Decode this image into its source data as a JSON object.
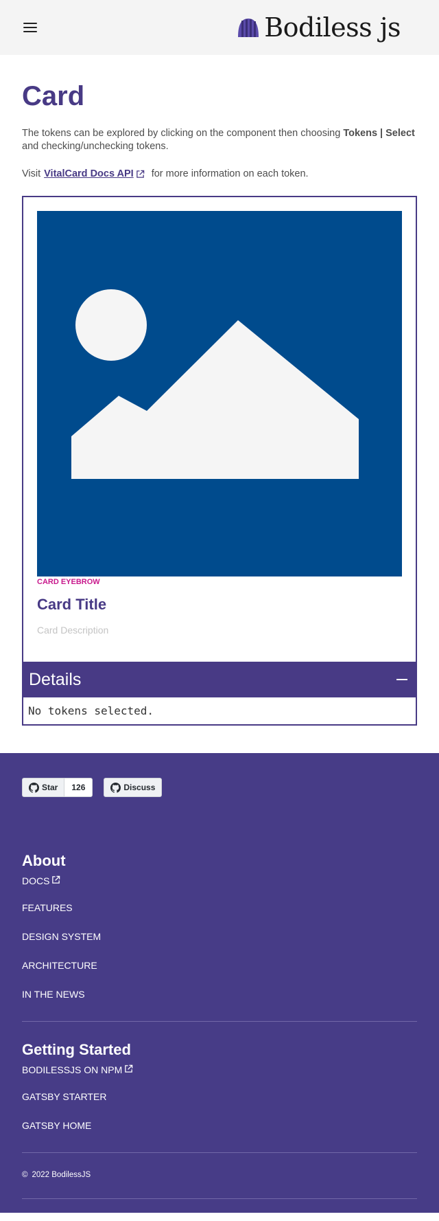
{
  "header": {
    "brand_name": "Bodiless js",
    "brand_mark": "beanie-logo-icon",
    "menu_icon": "hamburger-menu-icon"
  },
  "main": {
    "title": "Card",
    "intro_text": "The tokens can be explored by clicking on the component then choosing ",
    "intro_bold": "Tokens | Select",
    "intro_text2": " and checking/unchecking tokens.",
    "visit_prefix": "Visit",
    "visit_link": "VitalCard Docs API",
    "visit_suffix": "for more information on each token."
  },
  "card": {
    "image_icon": "image-placeholder-icon",
    "eyebrow": "CARD EYEBROW",
    "title": "Card Title",
    "description": "Card Description"
  },
  "details": {
    "title": "Details",
    "body": "No tokens selected."
  },
  "footer": {
    "github_star_label": "Star",
    "github_star_count": "126",
    "github_discuss_label": "Discuss",
    "about": {
      "heading": "About",
      "items": [
        "DOCS",
        "FEATURES",
        "DESIGN SYSTEM",
        "ARCHITECTURE",
        "IN THE NEWS"
      ]
    },
    "getting_started": {
      "heading": "Getting Started",
      "items": [
        "BODILESSJS ON NPM",
        "GATSBY STARTER",
        "GATSBY HOME"
      ]
    },
    "copyright": "2022 BodilessJS"
  },
  "colors": {
    "brand_purple": "#483a85",
    "footer_purple": "#473c87",
    "image_blue": "#004b8d",
    "eyebrow_magenta": "#c8198c"
  }
}
